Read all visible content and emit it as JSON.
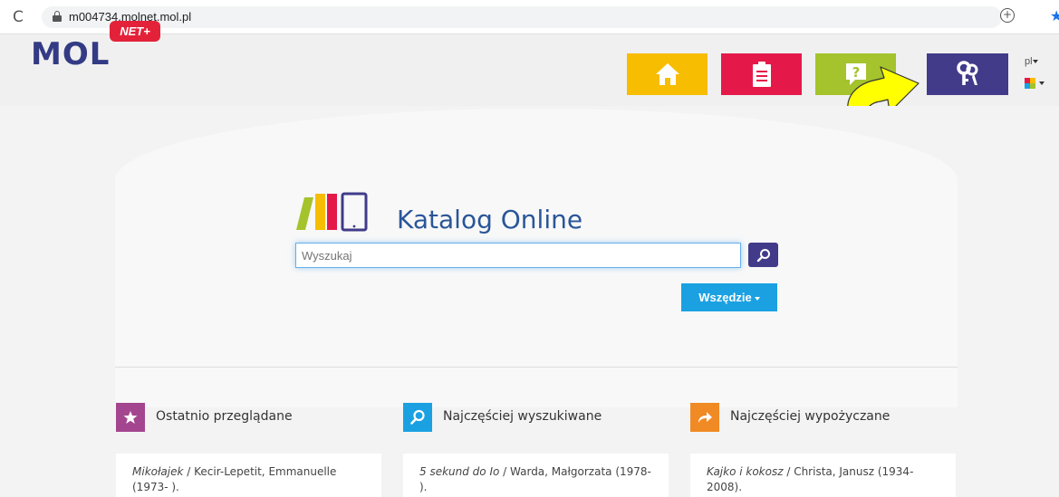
{
  "browser": {
    "reload_glyph": "C",
    "url": "m004734.molnet.mol.pl",
    "zoom_glyph": "⊕",
    "star_glyph": "★"
  },
  "header": {
    "logo_text": "MOL",
    "logo_badge": "NET+",
    "nav_tiles": [
      {
        "name": "home",
        "icon": "home-icon",
        "color": "#f7bd00"
      },
      {
        "name": "documents",
        "icon": "clipboard-icon",
        "color": "#e51949"
      },
      {
        "name": "help",
        "icon": "question-icon",
        "color": "#a4c32c"
      },
      {
        "name": "login",
        "icon": "keys-icon",
        "color": "#413b8a"
      }
    ],
    "language": "pl",
    "theme_icon": "color-squares-icon"
  },
  "annotation": {
    "icon": "yellow-curved-arrow",
    "color": "#ffff00"
  },
  "catalog": {
    "title": "Katalog Online",
    "logo_colors": [
      "#a4c32c",
      "#f7bd00",
      "#e51949",
      "#413b8a"
    ]
  },
  "search": {
    "placeholder": "Wyszukaj",
    "button_icon": "search-icon",
    "scope_label": "Wszędzie"
  },
  "sections": [
    {
      "title": "Ostatnio przeglądane",
      "icon": "star-icon",
      "color": "#a4458f",
      "item": {
        "title": "Mikołajek",
        "rest": " / Kecir-Lepetit, Emmanuelle (1973- )."
      }
    },
    {
      "title": "Najczęściej wyszukiwane",
      "icon": "search-icon",
      "color": "#1ba1e2",
      "item": {
        "title": "5 sekund do Io",
        "rest": " / Warda, Małgorzata (1978- )."
      }
    },
    {
      "title": "Najczęściej wypożyczane",
      "icon": "share-arrow-icon",
      "color": "#f08a24",
      "item": {
        "title": "Kajko i kokosz",
        "rest": " / Christa, Janusz (1934-2008)."
      }
    }
  ]
}
